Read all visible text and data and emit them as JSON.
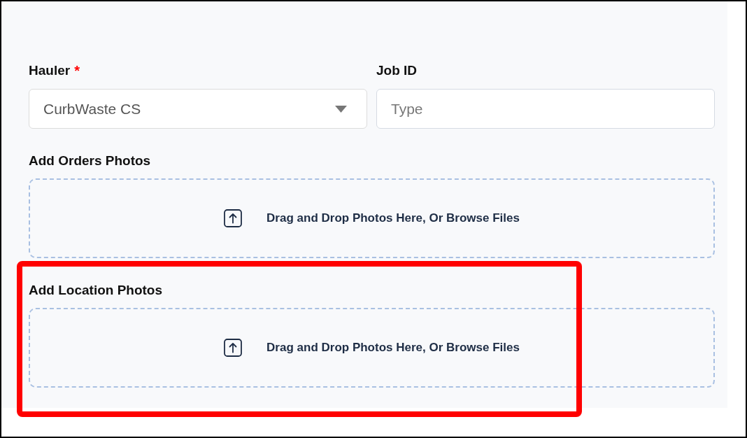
{
  "fields": [
    {
      "kind": "select",
      "label": "Hauler",
      "required_mark": "*",
      "value": "CurbWaste CS"
    },
    {
      "kind": "text",
      "label": "Job ID",
      "placeholder": "Type"
    }
  ],
  "upload_sections": [
    {
      "label": "Add Orders Photos",
      "prompt": "Drag and Drop Photos Here, Or Browse Files",
      "highlighted": false
    },
    {
      "label": "Add Location Photos",
      "prompt": "Drag and Drop Photos Here, Or Browse Files",
      "highlighted": true
    }
  ]
}
